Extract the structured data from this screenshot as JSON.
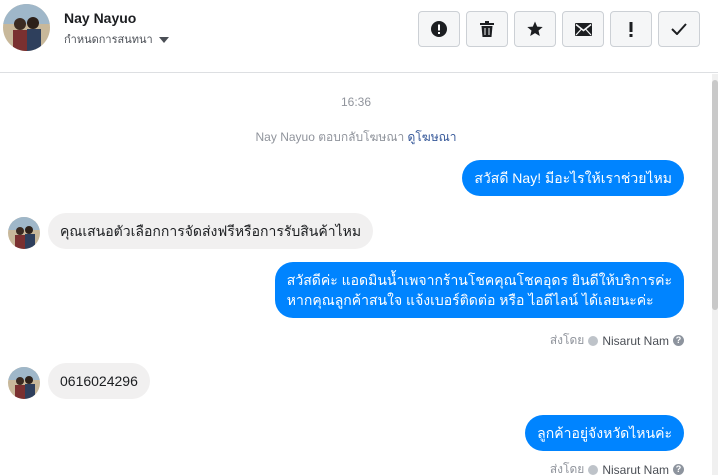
{
  "header": {
    "contact_name": "Nay Nayuo",
    "subtitle": "กำหนดการสนทนา"
  },
  "toolbar": {
    "buttons": [
      "report-icon",
      "trash-icon",
      "star-icon",
      "mail-icon",
      "exclamation-icon",
      "check-icon"
    ]
  },
  "chat": {
    "timestamp": "16:36",
    "notice_text": "Nay Nayuo ตอบกลับโฆษณา",
    "notice_link": "ดูโฆษณา",
    "messages": [
      {
        "direction": "out",
        "lines": [
          "สวัสดี Nay! มีอะไรให้เราช่วยไหม"
        ]
      },
      {
        "direction": "in",
        "lines": [
          "คุณเสนอตัวเลือกการจัดส่งฟรีหรือการรับสินค้าไหม"
        ]
      },
      {
        "direction": "out",
        "lines": [
          "สวัสดีค่ะ แอดมินน้ำเพจากร้านโชคคุณโชคอุดร ยินดีให้บริการค่ะ",
          "หากคุณลูกค้าสนใจ แจ้งเบอร์ติดต่อ หรือ ไอดีไลน์ ได้เลยนะค่ะ"
        ]
      },
      {
        "direction": "in",
        "lines": [
          "0616024296"
        ]
      },
      {
        "direction": "out",
        "lines": [
          "ลูกค้าอยู่จังหวัดไหนค่ะ"
        ]
      }
    ],
    "sent_by_label": "ส่งโดย",
    "sent_by_name": "Nisarut Nam",
    "help_glyph": "?"
  },
  "colors": {
    "outgoing_bubble": "#0084ff",
    "incoming_bubble": "#f1f0f0",
    "meta_text": "#90949c",
    "link": "#365899"
  }
}
